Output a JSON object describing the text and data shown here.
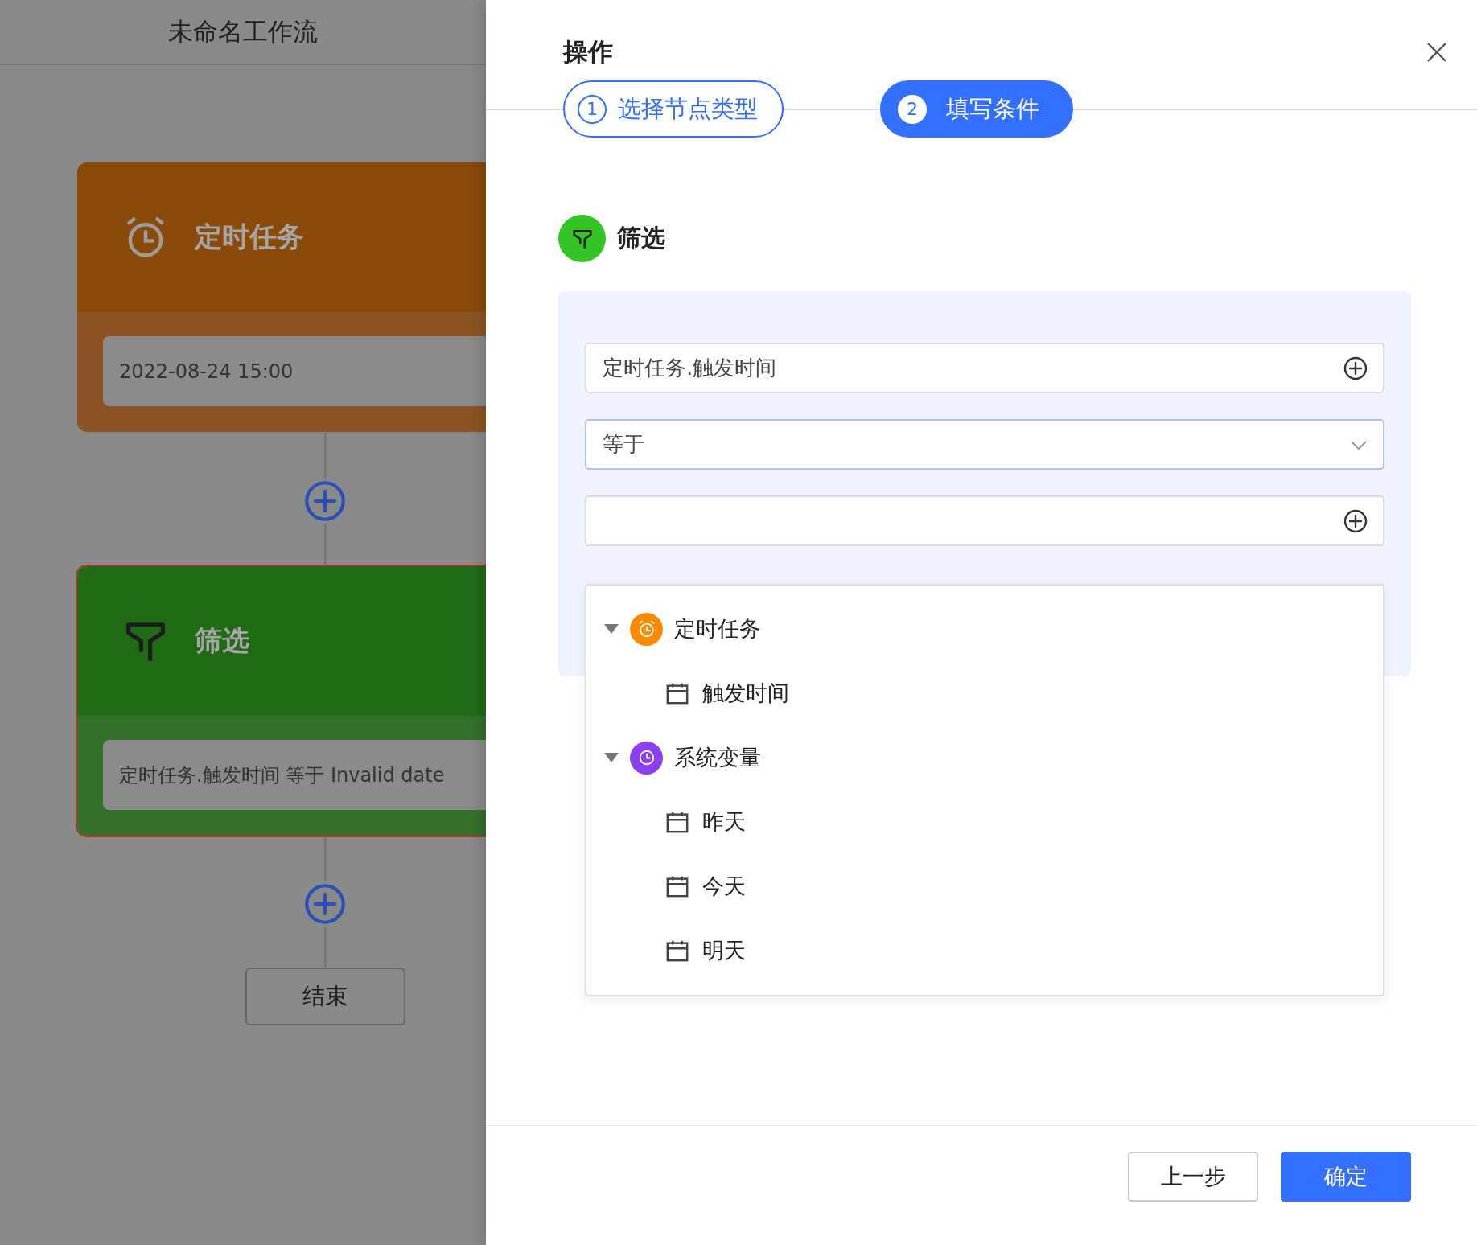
{
  "canvas": {
    "title": "未命名工作流",
    "nodes": [
      {
        "kind": "trigger",
        "title": "定时任务",
        "summary": "2022-08-24 15:00",
        "selected": false
      },
      {
        "kind": "filter",
        "title": "筛选",
        "summary": "定时任务.触发时间 等于 Invalid date",
        "selected": true
      }
    ],
    "end_node": "结束"
  },
  "drawer": {
    "title": "操作",
    "steps": [
      {
        "number": "1",
        "label": "选择节点类型",
        "selected": false
      },
      {
        "number": "2",
        "label": "填写条件",
        "selected": true
      }
    ],
    "section": {
      "kind": "filter",
      "title": "筛选"
    },
    "fields": [
      {
        "kind": "variable",
        "value": "定时任务.触发时间"
      },
      {
        "kind": "select",
        "value": "等于"
      },
      {
        "kind": "variable"
      }
    ],
    "variable_tree": [
      {
        "label": "定时任务",
        "kind": "trigger",
        "color": "#ff8a00",
        "expanded": true,
        "children": [
          {
            "label": "触发时间"
          }
        ]
      },
      {
        "label": "系统变量",
        "kind": "system",
        "color": "#8a3ff0",
        "expanded": true,
        "children": [
          {
            "label": "昨天"
          },
          {
            "label": "今天"
          },
          {
            "label": "明天"
          }
        ]
      }
    ],
    "buttons": [
      {
        "label": "上一步",
        "kind": "secondary"
      },
      {
        "label": "确定",
        "kind": "primary"
      }
    ]
  }
}
